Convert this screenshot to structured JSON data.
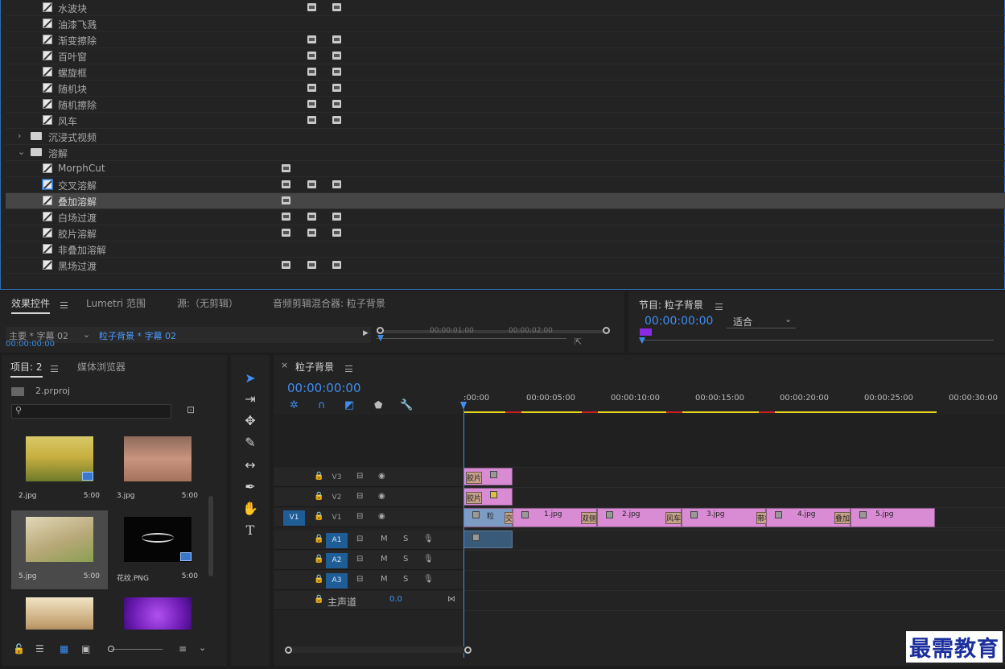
{
  "effects": {
    "rows": [
      {
        "label": "水波块",
        "badges": [
          32,
          100
        ]
      },
      {
        "label": "油漆飞溅",
        "badges": []
      },
      {
        "label": "渐变擦除",
        "badges": [
          32,
          100
        ]
      },
      {
        "label": "百叶窗",
        "badges": [
          32,
          100
        ]
      },
      {
        "label": "螺旋框",
        "badges": [
          32,
          100
        ]
      },
      {
        "label": "随机块",
        "badges": [
          32,
          100
        ]
      },
      {
        "label": "随机擦除",
        "badges": [
          32,
          100
        ]
      },
      {
        "label": "风车",
        "badges": [
          32,
          100
        ]
      }
    ],
    "folders": [
      {
        "label": "沉浸式视频",
        "expanded": false
      },
      {
        "label": "溶解",
        "expanded": true
      }
    ],
    "dissolve_rows": [
      {
        "label": "MorphCut",
        "badges": [
          "gpu"
        ]
      },
      {
        "label": "交叉溶解",
        "badges": [
          "gpu",
          32,
          100
        ],
        "highlight": true
      },
      {
        "label": "叠加溶解",
        "badges": [
          "gpu"
        ],
        "selected": true
      },
      {
        "label": "白场过渡",
        "badges": [
          "gpu",
          32,
          100
        ]
      },
      {
        "label": "胶片溶解",
        "badges": [
          "gpu",
          32,
          100
        ]
      },
      {
        "label": "非叠加溶解",
        "badges": []
      },
      {
        "label": "黑场过渡",
        "badges": [
          "gpu",
          32,
          100
        ]
      }
    ]
  },
  "effect_controls": {
    "tabs": [
      "效果控件",
      "Lumetri 范围",
      "源:（无剪辑）",
      "音频剪辑混合器: 粒子背景"
    ],
    "master_label": "主要 * 字幕 02",
    "clip_label": "粒子背景 * 字幕 02",
    "timecode": "00:00:00:00",
    "ruler_marks": [
      "00:00:01:00",
      "00:00:02:00"
    ]
  },
  "program": {
    "title": "节目: 粒子背景",
    "timecode": "00:00:00:00",
    "fit": "适合"
  },
  "project": {
    "tabs": [
      "项目: 2",
      "媒体浏览器"
    ],
    "file": "2.prproj",
    "search_placeholder": "",
    "items": [
      {
        "name": "2.jpg",
        "dur": "5:00"
      },
      {
        "name": "3.jpg",
        "dur": "5:00"
      },
      {
        "name": "5.jpg",
        "dur": "5:00"
      },
      {
        "name": "花纹.PNG",
        "dur": "5:00"
      },
      {
        "name": "",
        "dur": ""
      },
      {
        "name": "",
        "dur": ""
      }
    ]
  },
  "timeline": {
    "title": "粒子背景",
    "timecode": "00:00:00:00",
    "ruler": [
      ":00:00",
      "00:00:05:00",
      "00:00:10:00",
      "00:00:15:00",
      "00:00:20:00",
      "00:00:25:00",
      "00:00:30:00"
    ],
    "video_tracks": [
      "V3",
      "V2",
      "V1"
    ],
    "source_patch": "V1",
    "audio_tracks": [
      "A1",
      "A2",
      "A3"
    ],
    "audio_m": "M",
    "audio_s": "S",
    "master_label": "主声道",
    "master_value": "0.0",
    "v1_clips": [
      "粒",
      "1.jpg",
      "2.jpg",
      "3.jpg",
      "4.jpg",
      "5.jpg"
    ],
    "transitions": [
      "胶片",
      "胶片",
      "交叉",
      "双侧",
      "风车",
      "带状",
      "叠加"
    ]
  },
  "watermark": "最需教育"
}
